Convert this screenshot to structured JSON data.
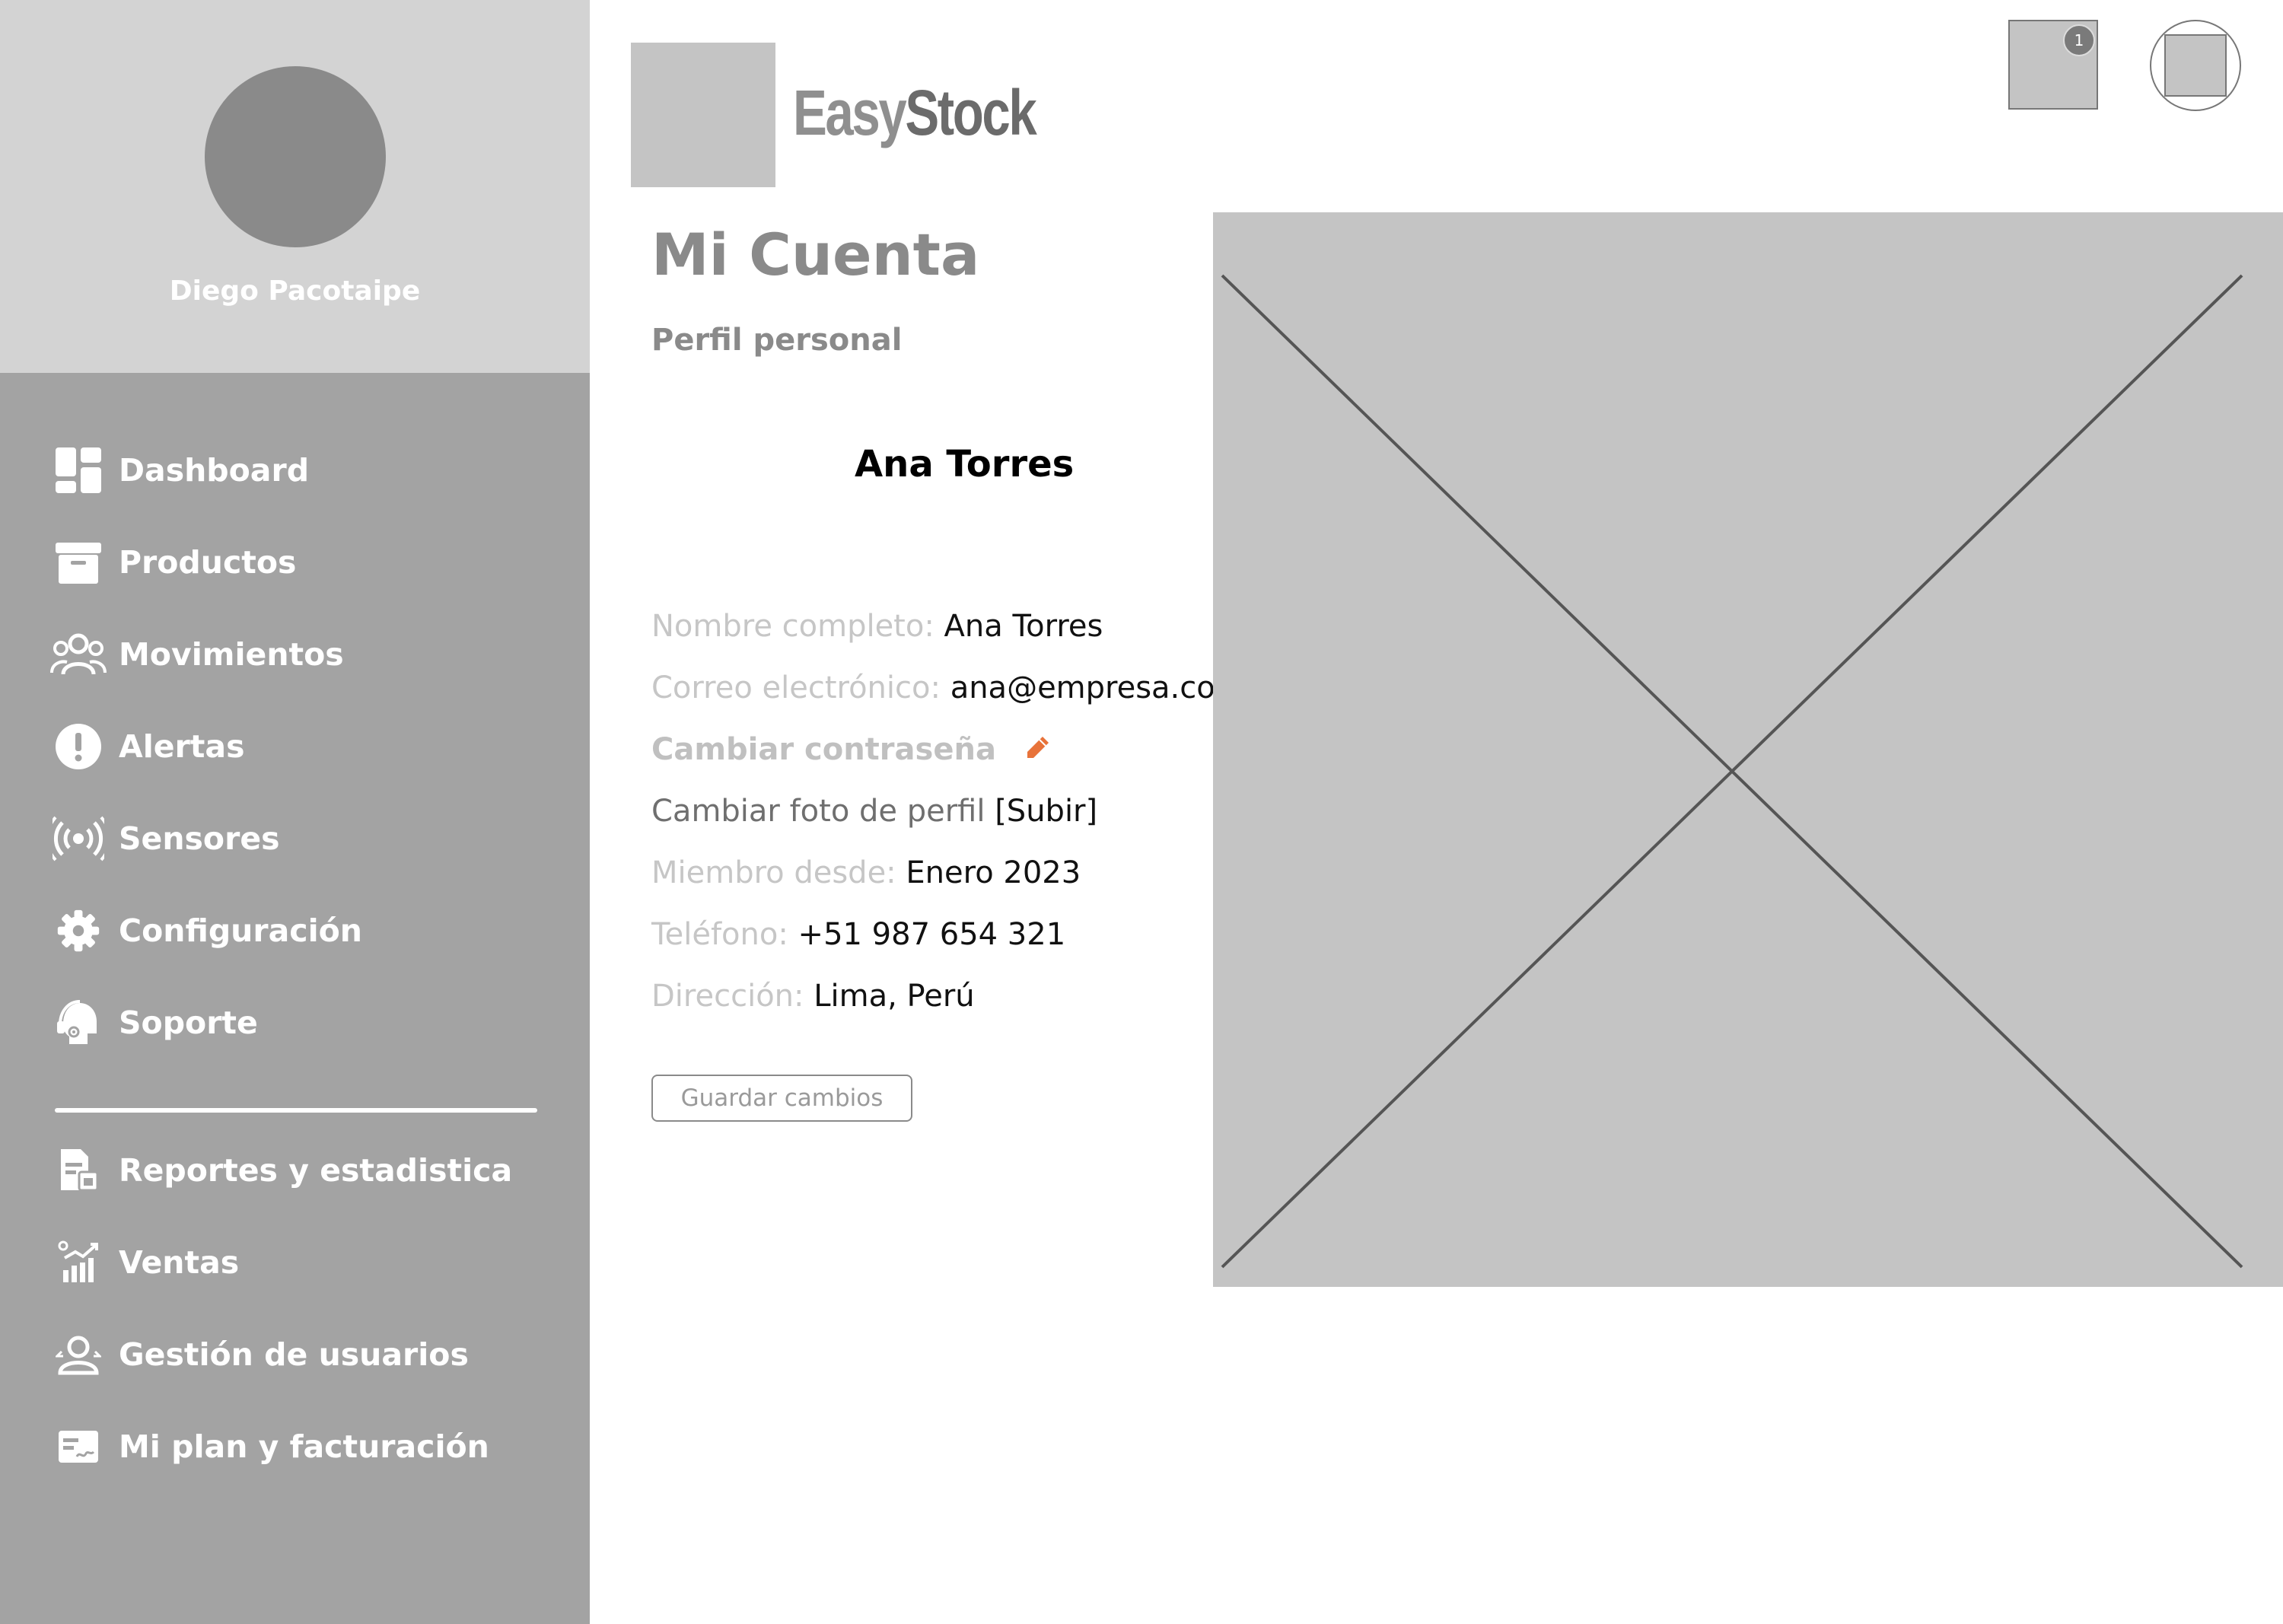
{
  "sidebar": {
    "profile": {
      "name": "Diego Pacotaipe"
    },
    "nav_items": [
      {
        "label": "Dashboard",
        "icon": "dashboard-icon"
      },
      {
        "label": "Productos",
        "icon": "archive-box-icon"
      },
      {
        "label": "Movimientos",
        "icon": "users-group-icon"
      },
      {
        "label": "Alertas",
        "icon": "alert-circle-icon"
      },
      {
        "label": "Sensores",
        "icon": "broadcast-sensor-icon"
      },
      {
        "label": "Configuración",
        "icon": "gear-icon"
      },
      {
        "label": "Soporte",
        "icon": "headset-support-icon"
      }
    ],
    "secondary_items": [
      {
        "label": "Reportes y estadistica",
        "icon": "report-document-icon"
      },
      {
        "label": "Ventas",
        "icon": "sales-chart-icon"
      },
      {
        "label": "Gestión de usuarios",
        "icon": "user-management-icon"
      },
      {
        "label": "Mi plan y facturación",
        "icon": "billing-card-icon"
      }
    ]
  },
  "header": {
    "brand_part1": "Easy",
    "brand_part2": "Stock",
    "notification_count": "1"
  },
  "main": {
    "title": "Mi Cuenta",
    "subtitle": "Perfil personal",
    "user_name": "Ana Torres",
    "fields": {
      "full_name": {
        "label": "Nombre completo:",
        "value": "Ana Torres"
      },
      "email": {
        "label": "Correo electrónico:",
        "value": "ana@empresa.com"
      },
      "change_password": {
        "label": "Cambiar contraseña"
      },
      "change_photo": {
        "label": "Cambiar foto de perfil",
        "action": "[Subir]"
      },
      "member_since": {
        "label": "Miembro desde:",
        "value": "Enero 2023"
      },
      "phone": {
        "label": "Teléfono:",
        "value": "+51 987 654 321"
      },
      "address": {
        "label": "Dirección:",
        "value": "Lima, Perú"
      }
    },
    "save_button": "Guardar cambios"
  },
  "colors": {
    "sidebar_bg": "#a3a3a3",
    "profile_bg": "#d3d3d3",
    "edit_accent": "#e8733a",
    "placeholder_bg": "#c4c4c4"
  }
}
